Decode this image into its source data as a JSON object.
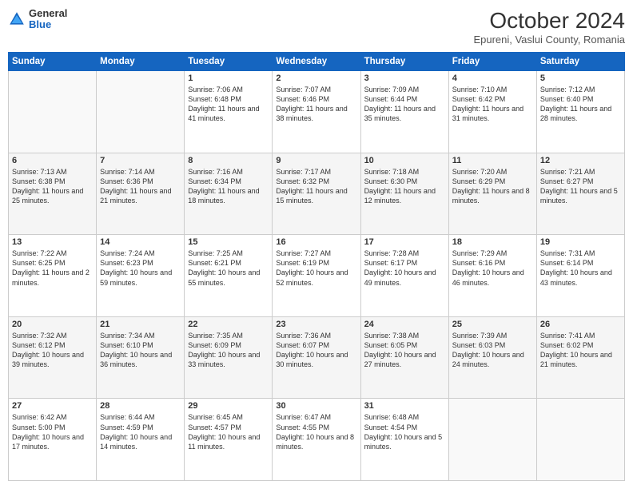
{
  "header": {
    "logo": {
      "general": "General",
      "blue": "Blue"
    },
    "title": "October 2024",
    "subtitle": "Epureni, Vaslui County, Romania"
  },
  "weekdays": [
    "Sunday",
    "Monday",
    "Tuesday",
    "Wednesday",
    "Thursday",
    "Friday",
    "Saturday"
  ],
  "weeks": [
    [
      {
        "day": "",
        "sunrise": "",
        "sunset": "",
        "daylight": ""
      },
      {
        "day": "",
        "sunrise": "",
        "sunset": "",
        "daylight": ""
      },
      {
        "day": "1",
        "sunrise": "Sunrise: 7:06 AM",
        "sunset": "Sunset: 6:48 PM",
        "daylight": "Daylight: 11 hours and 41 minutes."
      },
      {
        "day": "2",
        "sunrise": "Sunrise: 7:07 AM",
        "sunset": "Sunset: 6:46 PM",
        "daylight": "Daylight: 11 hours and 38 minutes."
      },
      {
        "day": "3",
        "sunrise": "Sunrise: 7:09 AM",
        "sunset": "Sunset: 6:44 PM",
        "daylight": "Daylight: 11 hours and 35 minutes."
      },
      {
        "day": "4",
        "sunrise": "Sunrise: 7:10 AM",
        "sunset": "Sunset: 6:42 PM",
        "daylight": "Daylight: 11 hours and 31 minutes."
      },
      {
        "day": "5",
        "sunrise": "Sunrise: 7:12 AM",
        "sunset": "Sunset: 6:40 PM",
        "daylight": "Daylight: 11 hours and 28 minutes."
      }
    ],
    [
      {
        "day": "6",
        "sunrise": "Sunrise: 7:13 AM",
        "sunset": "Sunset: 6:38 PM",
        "daylight": "Daylight: 11 hours and 25 minutes."
      },
      {
        "day": "7",
        "sunrise": "Sunrise: 7:14 AM",
        "sunset": "Sunset: 6:36 PM",
        "daylight": "Daylight: 11 hours and 21 minutes."
      },
      {
        "day": "8",
        "sunrise": "Sunrise: 7:16 AM",
        "sunset": "Sunset: 6:34 PM",
        "daylight": "Daylight: 11 hours and 18 minutes."
      },
      {
        "day": "9",
        "sunrise": "Sunrise: 7:17 AM",
        "sunset": "Sunset: 6:32 PM",
        "daylight": "Daylight: 11 hours and 15 minutes."
      },
      {
        "day": "10",
        "sunrise": "Sunrise: 7:18 AM",
        "sunset": "Sunset: 6:30 PM",
        "daylight": "Daylight: 11 hours and 12 minutes."
      },
      {
        "day": "11",
        "sunrise": "Sunrise: 7:20 AM",
        "sunset": "Sunset: 6:29 PM",
        "daylight": "Daylight: 11 hours and 8 minutes."
      },
      {
        "day": "12",
        "sunrise": "Sunrise: 7:21 AM",
        "sunset": "Sunset: 6:27 PM",
        "daylight": "Daylight: 11 hours and 5 minutes."
      }
    ],
    [
      {
        "day": "13",
        "sunrise": "Sunrise: 7:22 AM",
        "sunset": "Sunset: 6:25 PM",
        "daylight": "Daylight: 11 hours and 2 minutes."
      },
      {
        "day": "14",
        "sunrise": "Sunrise: 7:24 AM",
        "sunset": "Sunset: 6:23 PM",
        "daylight": "Daylight: 10 hours and 59 minutes."
      },
      {
        "day": "15",
        "sunrise": "Sunrise: 7:25 AM",
        "sunset": "Sunset: 6:21 PM",
        "daylight": "Daylight: 10 hours and 55 minutes."
      },
      {
        "day": "16",
        "sunrise": "Sunrise: 7:27 AM",
        "sunset": "Sunset: 6:19 PM",
        "daylight": "Daylight: 10 hours and 52 minutes."
      },
      {
        "day": "17",
        "sunrise": "Sunrise: 7:28 AM",
        "sunset": "Sunset: 6:17 PM",
        "daylight": "Daylight: 10 hours and 49 minutes."
      },
      {
        "day": "18",
        "sunrise": "Sunrise: 7:29 AM",
        "sunset": "Sunset: 6:16 PM",
        "daylight": "Daylight: 10 hours and 46 minutes."
      },
      {
        "day": "19",
        "sunrise": "Sunrise: 7:31 AM",
        "sunset": "Sunset: 6:14 PM",
        "daylight": "Daylight: 10 hours and 43 minutes."
      }
    ],
    [
      {
        "day": "20",
        "sunrise": "Sunrise: 7:32 AM",
        "sunset": "Sunset: 6:12 PM",
        "daylight": "Daylight: 10 hours and 39 minutes."
      },
      {
        "day": "21",
        "sunrise": "Sunrise: 7:34 AM",
        "sunset": "Sunset: 6:10 PM",
        "daylight": "Daylight: 10 hours and 36 minutes."
      },
      {
        "day": "22",
        "sunrise": "Sunrise: 7:35 AM",
        "sunset": "Sunset: 6:09 PM",
        "daylight": "Daylight: 10 hours and 33 minutes."
      },
      {
        "day": "23",
        "sunrise": "Sunrise: 7:36 AM",
        "sunset": "Sunset: 6:07 PM",
        "daylight": "Daylight: 10 hours and 30 minutes."
      },
      {
        "day": "24",
        "sunrise": "Sunrise: 7:38 AM",
        "sunset": "Sunset: 6:05 PM",
        "daylight": "Daylight: 10 hours and 27 minutes."
      },
      {
        "day": "25",
        "sunrise": "Sunrise: 7:39 AM",
        "sunset": "Sunset: 6:03 PM",
        "daylight": "Daylight: 10 hours and 24 minutes."
      },
      {
        "day": "26",
        "sunrise": "Sunrise: 7:41 AM",
        "sunset": "Sunset: 6:02 PM",
        "daylight": "Daylight: 10 hours and 21 minutes."
      }
    ],
    [
      {
        "day": "27",
        "sunrise": "Sunrise: 6:42 AM",
        "sunset": "Sunset: 5:00 PM",
        "daylight": "Daylight: 10 hours and 17 minutes."
      },
      {
        "day": "28",
        "sunrise": "Sunrise: 6:44 AM",
        "sunset": "Sunset: 4:59 PM",
        "daylight": "Daylight: 10 hours and 14 minutes."
      },
      {
        "day": "29",
        "sunrise": "Sunrise: 6:45 AM",
        "sunset": "Sunset: 4:57 PM",
        "daylight": "Daylight: 10 hours and 11 minutes."
      },
      {
        "day": "30",
        "sunrise": "Sunrise: 6:47 AM",
        "sunset": "Sunset: 4:55 PM",
        "daylight": "Daylight: 10 hours and 8 minutes."
      },
      {
        "day": "31",
        "sunrise": "Sunrise: 6:48 AM",
        "sunset": "Sunset: 4:54 PM",
        "daylight": "Daylight: 10 hours and 5 minutes."
      },
      {
        "day": "",
        "sunrise": "",
        "sunset": "",
        "daylight": ""
      },
      {
        "day": "",
        "sunrise": "",
        "sunset": "",
        "daylight": ""
      }
    ]
  ]
}
